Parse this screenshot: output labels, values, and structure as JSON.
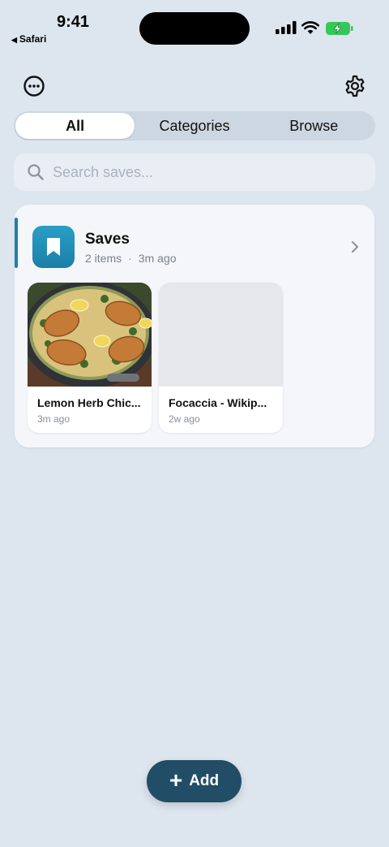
{
  "status_bar": {
    "time": "9:41",
    "back_app": "Safari",
    "battery_color": "#34c759"
  },
  "header": {
    "more_icon": "ellipsis-circle-icon",
    "settings_icon": "gear-icon"
  },
  "tabs": [
    {
      "label": "All",
      "active": true
    },
    {
      "label": "Categories",
      "active": false
    },
    {
      "label": "Browse",
      "active": false
    }
  ],
  "search": {
    "placeholder": "Search saves...",
    "value": ""
  },
  "collection": {
    "title": "Saves",
    "count": "2 items",
    "separator": "·",
    "updated": "3m ago",
    "icon": "bookmark-icon",
    "accent_color": "#1f7fa7",
    "items": [
      {
        "title": "Lemon Herb Chic...",
        "time": "3m ago",
        "has_image": true
      },
      {
        "title": "Focaccia - Wikip...",
        "time": "2w ago",
        "has_image": false
      }
    ]
  },
  "add_button": {
    "label": "Add",
    "color": "#214d66"
  }
}
